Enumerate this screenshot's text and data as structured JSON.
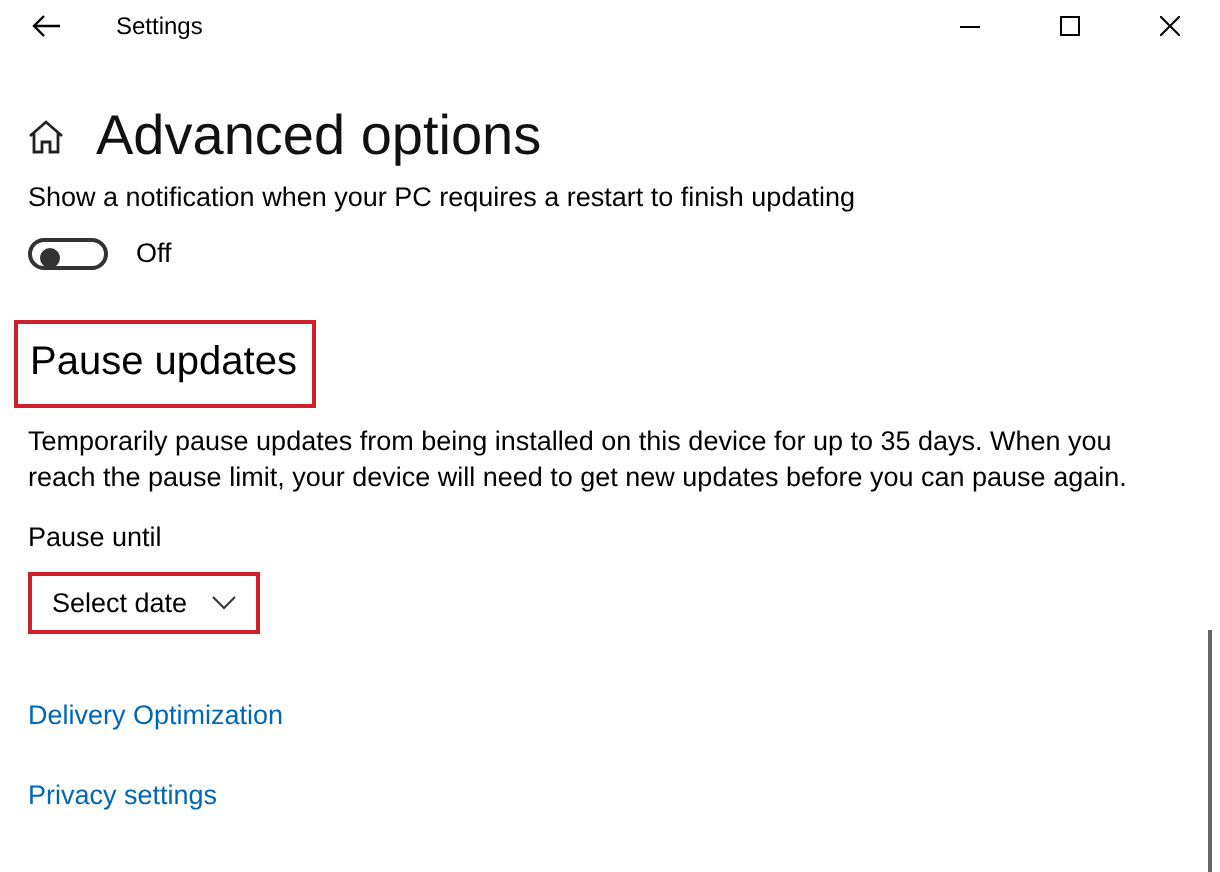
{
  "window": {
    "title": "Settings"
  },
  "page": {
    "title": "Advanced options"
  },
  "notification": {
    "label": "Show a notification when your PC requires a restart to finish updating",
    "on": false,
    "state_text": "Off"
  },
  "pause": {
    "title": "Pause updates",
    "highlighted": true,
    "description": "Temporarily pause updates from being installed on this device for up to 35 days. When you reach the pause limit, your device will need to get new updates before you can pause again.",
    "field_label": "Pause until",
    "dropdown": {
      "value": "Select date",
      "highlighted": true
    }
  },
  "links": [
    "Delivery Optimization",
    "Privacy settings"
  ]
}
